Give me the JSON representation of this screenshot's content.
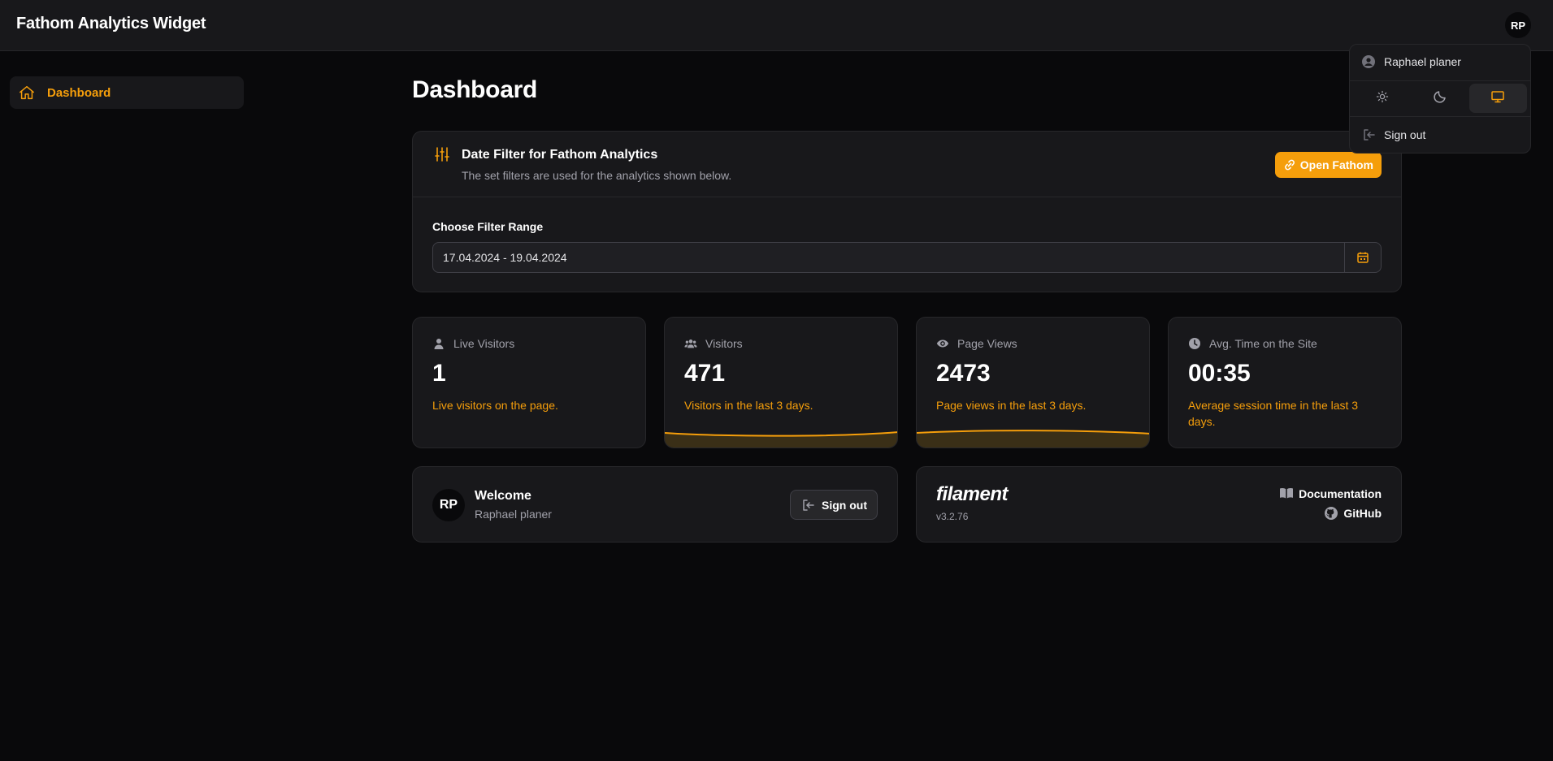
{
  "app": {
    "title": "Fathom Analytics Widget"
  },
  "user": {
    "initials": "RP",
    "name": "Raphael planer"
  },
  "colors": {
    "accent": "#f59e0b",
    "background": "#09090b",
    "card": "#18181b",
    "border": "#27272a"
  },
  "sidebar": {
    "items": [
      {
        "label": "Dashboard",
        "icon": "home-icon",
        "active": true
      }
    ]
  },
  "main": {
    "title": "Dashboard",
    "filter": {
      "title": "Date Filter for Fathom Analytics",
      "description": "The set filters are used for the analytics shown below.",
      "open_label": "Open Fathom",
      "range_label": "Choose Filter Range",
      "range_value": "17.04.2024 - 19.04.2024"
    },
    "stats": [
      {
        "label": "Live Visitors",
        "icon": "user-icon",
        "value": "1",
        "description": "Live visitors on the page.",
        "sparkline": false
      },
      {
        "label": "Visitors",
        "icon": "users-icon",
        "value": "471",
        "description": "Visitors in the last 3 days.",
        "sparkline": true
      },
      {
        "label": "Page Views",
        "icon": "eye-icon",
        "value": "2473",
        "description": "Page views in the last 3 days.",
        "sparkline": true
      },
      {
        "label": "Avg. Time on the Site",
        "icon": "clock-icon",
        "value": "00:35",
        "description": "Average session time in the last 3 days.",
        "sparkline": false
      }
    ],
    "welcome": {
      "title": "Welcome",
      "signout_label": "Sign out"
    },
    "filament": {
      "logo": "filament",
      "version": "v3.2.76",
      "documentation_label": "Documentation",
      "github_label": "GitHub"
    }
  },
  "user_menu": {
    "themes": [
      {
        "name": "light",
        "icon": "sun-icon",
        "active": false
      },
      {
        "name": "dark",
        "icon": "moon-icon",
        "active": false
      },
      {
        "name": "system",
        "icon": "monitor-icon",
        "active": true
      }
    ],
    "signout_label": "Sign out"
  }
}
